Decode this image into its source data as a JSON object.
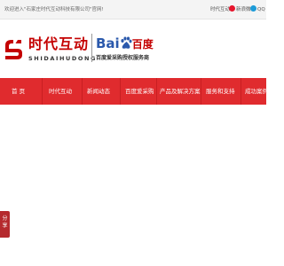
{
  "topbar": {
    "welcome": "欢迎进入\"石家庄时代互动科技有限公司\"官网!",
    "links": [
      {
        "label": "时代互动",
        "icon": null
      },
      {
        "label": "新浪微博",
        "icon": "weibo-icon"
      },
      {
        "label": "QQ",
        "icon": "qq-icon"
      }
    ]
  },
  "header": {
    "logo_cn": "时代互动",
    "logo_en": "SHIDAIHUDONG",
    "baidu_bai": "Bai",
    "baidu_du": "百度",
    "baidu_sub": "百度爱采购授权服务商"
  },
  "nav": {
    "items": [
      "首  页",
      "时代互动",
      "新闻动态",
      "百度爱采购",
      "产品及解决方案",
      "服务和支持",
      "成功案例"
    ]
  },
  "share": {
    "chars": [
      "分",
      "享"
    ]
  },
  "colors": {
    "brand_red": "#e02b2e",
    "logo_red": "#c40000",
    "baidu_blue": "#2b59ac",
    "share_red": "#b52a2e"
  }
}
